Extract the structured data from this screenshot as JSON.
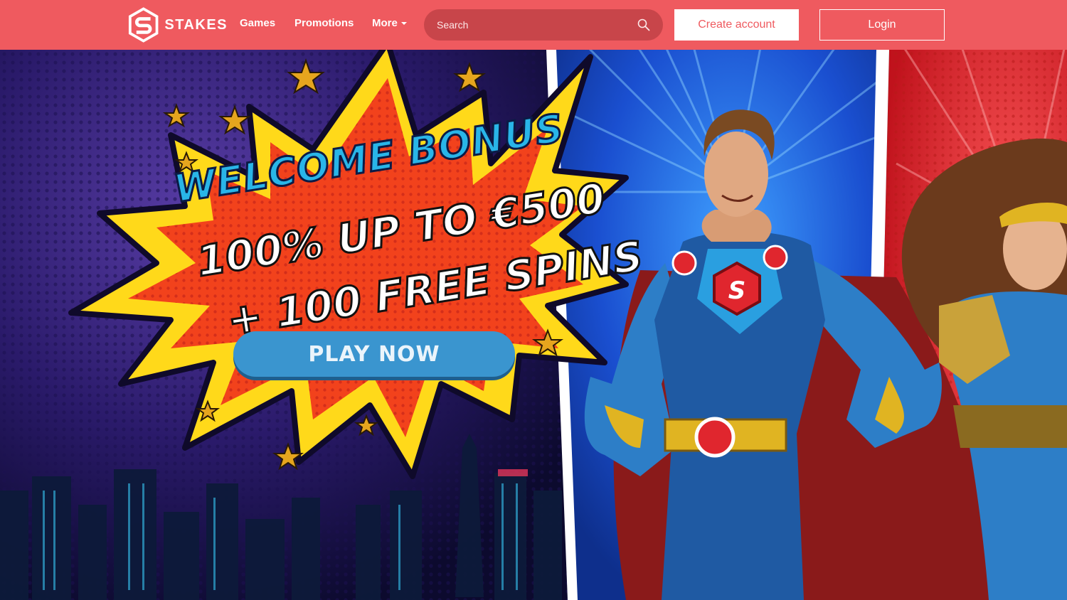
{
  "brand": {
    "name": "STAKES",
    "logo_icon": "stakes-s-hexagon-logo"
  },
  "nav": {
    "games": "Games",
    "promotions": "Promotions",
    "more": "More"
  },
  "search": {
    "placeholder": "Search",
    "icon": "search-icon"
  },
  "auth": {
    "create_account": "Create account",
    "login": "Login"
  },
  "hero": {
    "headline": "WELCOME BONUS",
    "offer_line1": "100% UP TO €500",
    "offer_line2": "+ 100 FREE SPINS",
    "cta": "PLAY NOW"
  },
  "colors": {
    "header_bg": "#ef5a5f",
    "search_bg": "#c8454a",
    "cta_bg": "#3a95cf",
    "headline": "#29b5e8"
  }
}
